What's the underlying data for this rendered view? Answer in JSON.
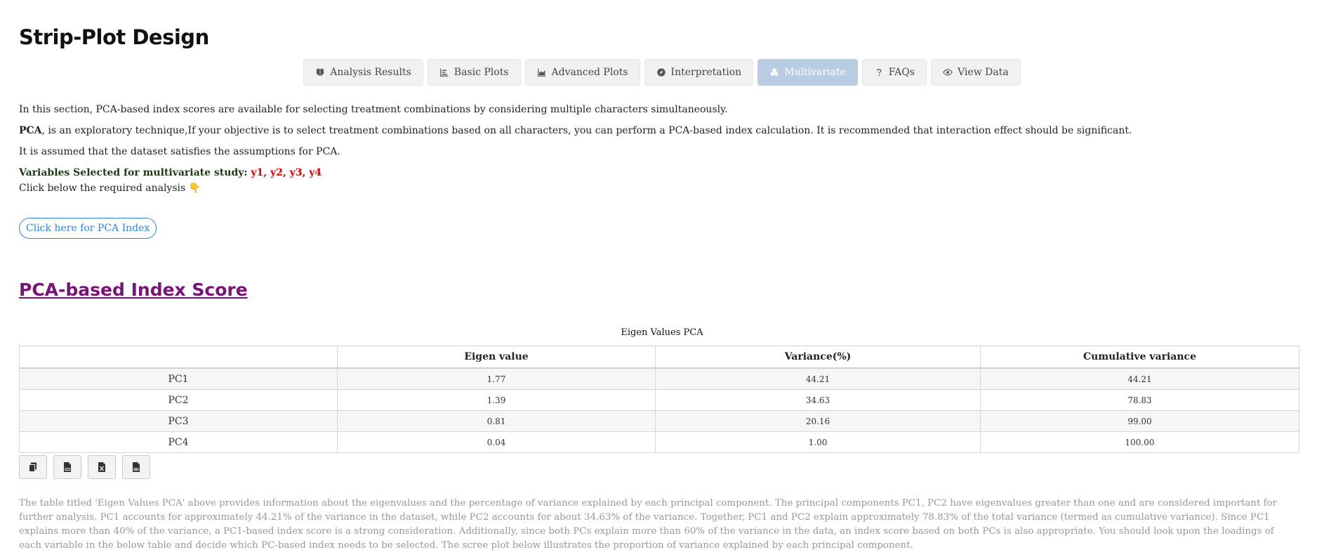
{
  "page": {
    "title": "Strip-Plot Design"
  },
  "tabs": [
    {
      "label": "Analysis Results",
      "icon": "brain-icon"
    },
    {
      "label": "Basic Plots",
      "icon": "bar-chart-icon"
    },
    {
      "label": "Advanced Plots",
      "icon": "area-chart-icon"
    },
    {
      "label": "Interpretation",
      "icon": "compass-icon"
    },
    {
      "label": "Multivariate",
      "icon": "circles-icon",
      "active": true
    },
    {
      "label": "FAQs",
      "icon": "question-icon"
    },
    {
      "label": "View Data",
      "icon": "eye-icon"
    }
  ],
  "intro": {
    "p1": "In this section, PCA-based index scores are available for selecting treatment combinations by considering multiple characters simultaneously.",
    "p2_bold": "PCA",
    "p2_rest": ", is an exploratory technique,If your objective is to select treatment combinations based on all characters, you can perform a PCA-based index calculation. It is recommended that interaction effect should be significant.",
    "p3": "It is assumed that the dataset satisfies the assumptions for PCA.",
    "vars_label": "Variables Selected for multivariate study:",
    "vars_value": "y1, y2, y3, y4",
    "click_prompt": "Click below the required analysis",
    "pointer_emoji": "👇"
  },
  "pca_button": {
    "label": "Click here for PCA Index"
  },
  "section": {
    "heading": "PCA-based Index Score"
  },
  "eigen_table": {
    "caption": "Eigen Values PCA",
    "columns": [
      "",
      "Eigen value",
      "Variance(%)",
      "Cumulative variance"
    ],
    "rows": [
      [
        "PC1",
        "1.77",
        "44.21",
        "44.21"
      ],
      [
        "PC2",
        "1.39",
        "34.63",
        "78.83"
      ],
      [
        "PC3",
        "0.81",
        "20.16",
        "99.00"
      ],
      [
        "PC4",
        "0.04",
        "1.00",
        "100.00"
      ]
    ]
  },
  "export_buttons": [
    {
      "name": "copy",
      "icon": "copy-icon"
    },
    {
      "name": "csv",
      "icon": "csv-file-icon"
    },
    {
      "name": "excel",
      "icon": "excel-file-icon"
    },
    {
      "name": "pdf",
      "icon": "pdf-file-icon"
    }
  ],
  "interpretation": "The table titled 'Eigen Values PCA' above provides information about the eigenvalues and the percentage of variance explained by each principal component. The principal components PC1, PC2 have eigenvalues greater than one and are considered important for further analysis. PC1 accounts for approximately 44.21% of the variance in the dataset, while PC2 accounts for about 34.63% of the variance. Together, PC1 and PC2 explain approximately 78.83% of the total variance (termed as cumulative variance). Since PC1 explains more than 40% of the variance, a PC1-based index score is a strong consideration. Additionally, since both PCs explain more than 60% of the variance in the data, an index score based on both PCs is also appropriate. You should look upon the loadings of each variable in the below table and decide which PC-based index needs to be selected. The scree plot below illustrates the proportion of variance explained by each principal component.",
  "colors": {
    "accent": "#2e86de",
    "heading": "#7a1279",
    "variables": "#e00000",
    "active_tab": "#b9cce4"
  }
}
